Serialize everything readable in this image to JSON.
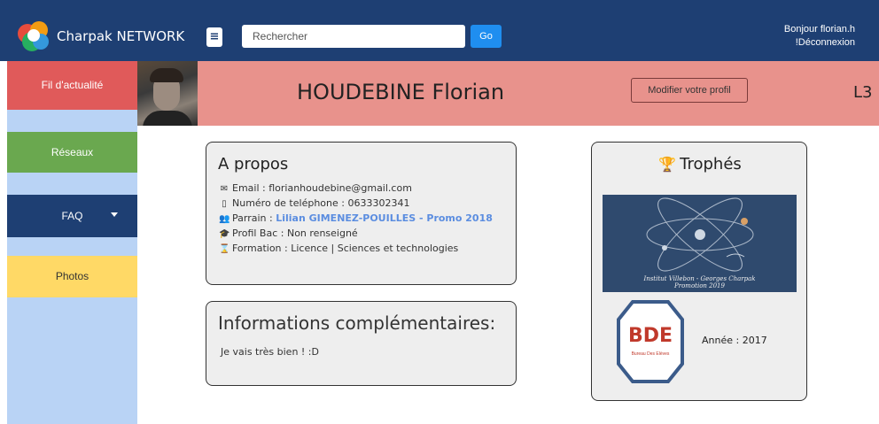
{
  "navbar": {
    "brand": "Charpak NETWORK",
    "search_placeholder": "Rechercher",
    "go_label": "Go",
    "greeting": "Bonjour florian.h",
    "logout": "!Déconnexion"
  },
  "sidebar": {
    "items": [
      {
        "label": "Fil d'actualité"
      },
      {
        "label": "Réseaux"
      },
      {
        "label": "FAQ"
      },
      {
        "label": "Photos"
      }
    ]
  },
  "profile": {
    "name": "HOUDEBINE Florian",
    "edit_label": "Modifier votre profil",
    "level": "L3"
  },
  "about": {
    "title": "A propos",
    "email": "Email : florianhoudebine@gmail.com",
    "phone": "Numéro de teléphone : 0633302341",
    "sponsor_label": "Parrain : ",
    "sponsor_link": "Lilian GIMENEZ-POUILLES - Promo 2018",
    "bac": "Profil Bac : Non renseigné",
    "formation": "Formation : Licence | Sciences et technologies"
  },
  "extra": {
    "title": "Informations complémentaires:",
    "text": "Je vais très bien ! :D"
  },
  "trophies": {
    "title": "Trophés",
    "banner_caption_1": "Institut Villebon - Georges Charpak",
    "banner_caption_2": "Promotion 2019",
    "bde_logo_text": "BDE",
    "bde_logo_sub": "Bureau Des Elèves",
    "year": "Année : 2017"
  }
}
